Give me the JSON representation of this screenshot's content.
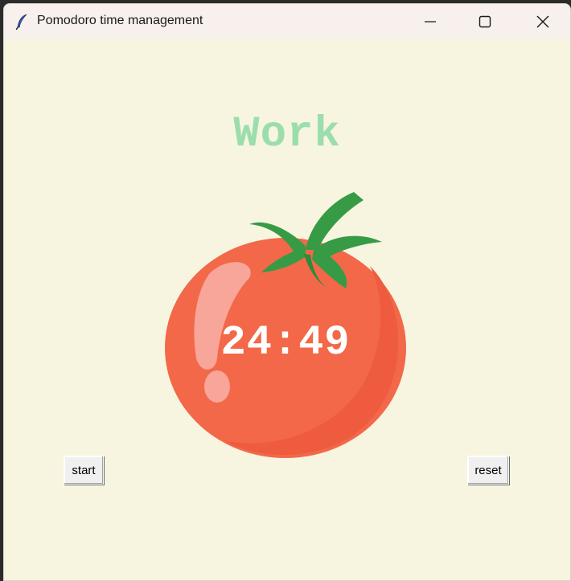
{
  "window": {
    "title": "Pomodoro time management",
    "controls": {
      "minimize": "minimize-icon",
      "maximize": "maximize-icon",
      "close": "close-icon"
    }
  },
  "main": {
    "phase_label": "Work",
    "timer": "24:49",
    "start_label": "start",
    "reset_label": "reset"
  },
  "colors": {
    "background": "#f7f5e0",
    "phase_label": "#9bdeac",
    "tomato": "#f26849",
    "leaf": "#379b46",
    "timer_text": "#ffffff"
  }
}
